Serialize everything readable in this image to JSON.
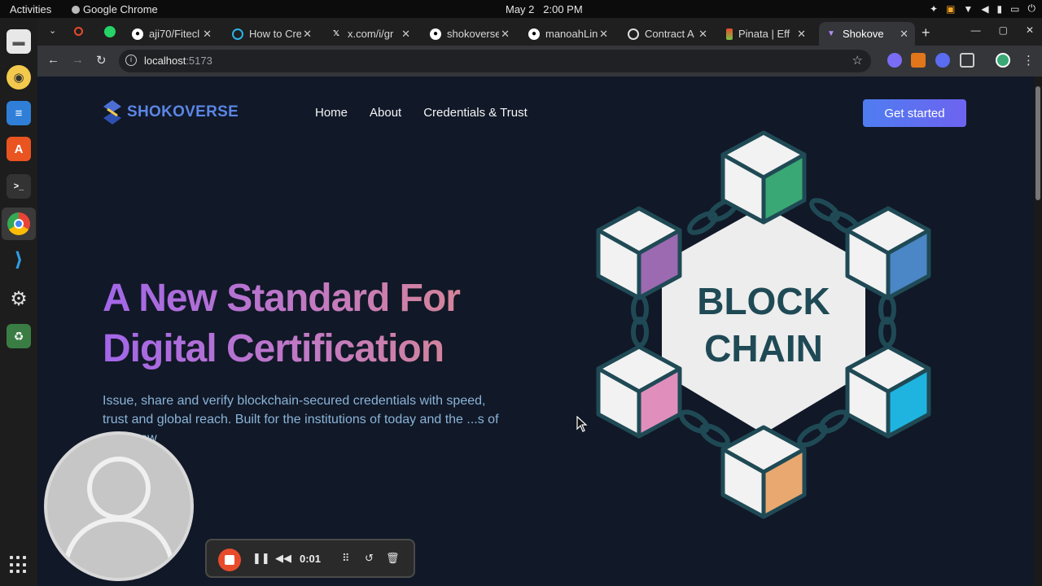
{
  "system": {
    "activities": "Activities",
    "app_name": "Google Chrome",
    "date": "May 2",
    "time": "2:00 PM"
  },
  "browser": {
    "tabs": [
      {
        "label": "aji70/Fitecl",
        "favicon": "github-icon"
      },
      {
        "label": "How to Cre",
        "favicon": "search-icon"
      },
      {
        "label": "x.com/i/gr",
        "favicon": "x-icon"
      },
      {
        "label": "shokoverse",
        "favicon": "github-icon"
      },
      {
        "label": "manoahLin",
        "favicon": "github-icon"
      },
      {
        "label": "Contract A",
        "favicon": "chart-icon"
      },
      {
        "label": "Pinata | Eff",
        "favicon": "pinata-icon"
      },
      {
        "label": "Shokove",
        "favicon": "vite-icon",
        "active": true
      }
    ],
    "url_host": "localhost",
    "url_port": ":5173"
  },
  "site": {
    "brand": "SHOKOVERSE",
    "nav": [
      "Home",
      "About",
      "Credentials & Trust"
    ],
    "cta": "Get started",
    "headline_line1": "A New Standard For",
    "headline_line2": "Digital Certification",
    "subtext": "Issue, share and verify blockchain-secured credentials with speed, trust and global reach. Built for the institutions of today and the ...s of tomorrow",
    "illustration_line1": "BLOCK",
    "illustration_line2": "CHAIN"
  },
  "recorder": {
    "elapsed": "0:01"
  },
  "colors": {
    "page_bg": "#111827",
    "brand_blue": "#5b86e5",
    "cta_gradient_start": "#4f7df0",
    "cta_gradient_end": "#6d63f0",
    "cube_green": "#3aa874",
    "cube_purple": "#9b6ab0",
    "cube_blue": "#4b86c6",
    "cube_pink": "#e08fbd",
    "cube_cyan": "#1fb4e0",
    "cube_orange": "#e9a86f"
  }
}
